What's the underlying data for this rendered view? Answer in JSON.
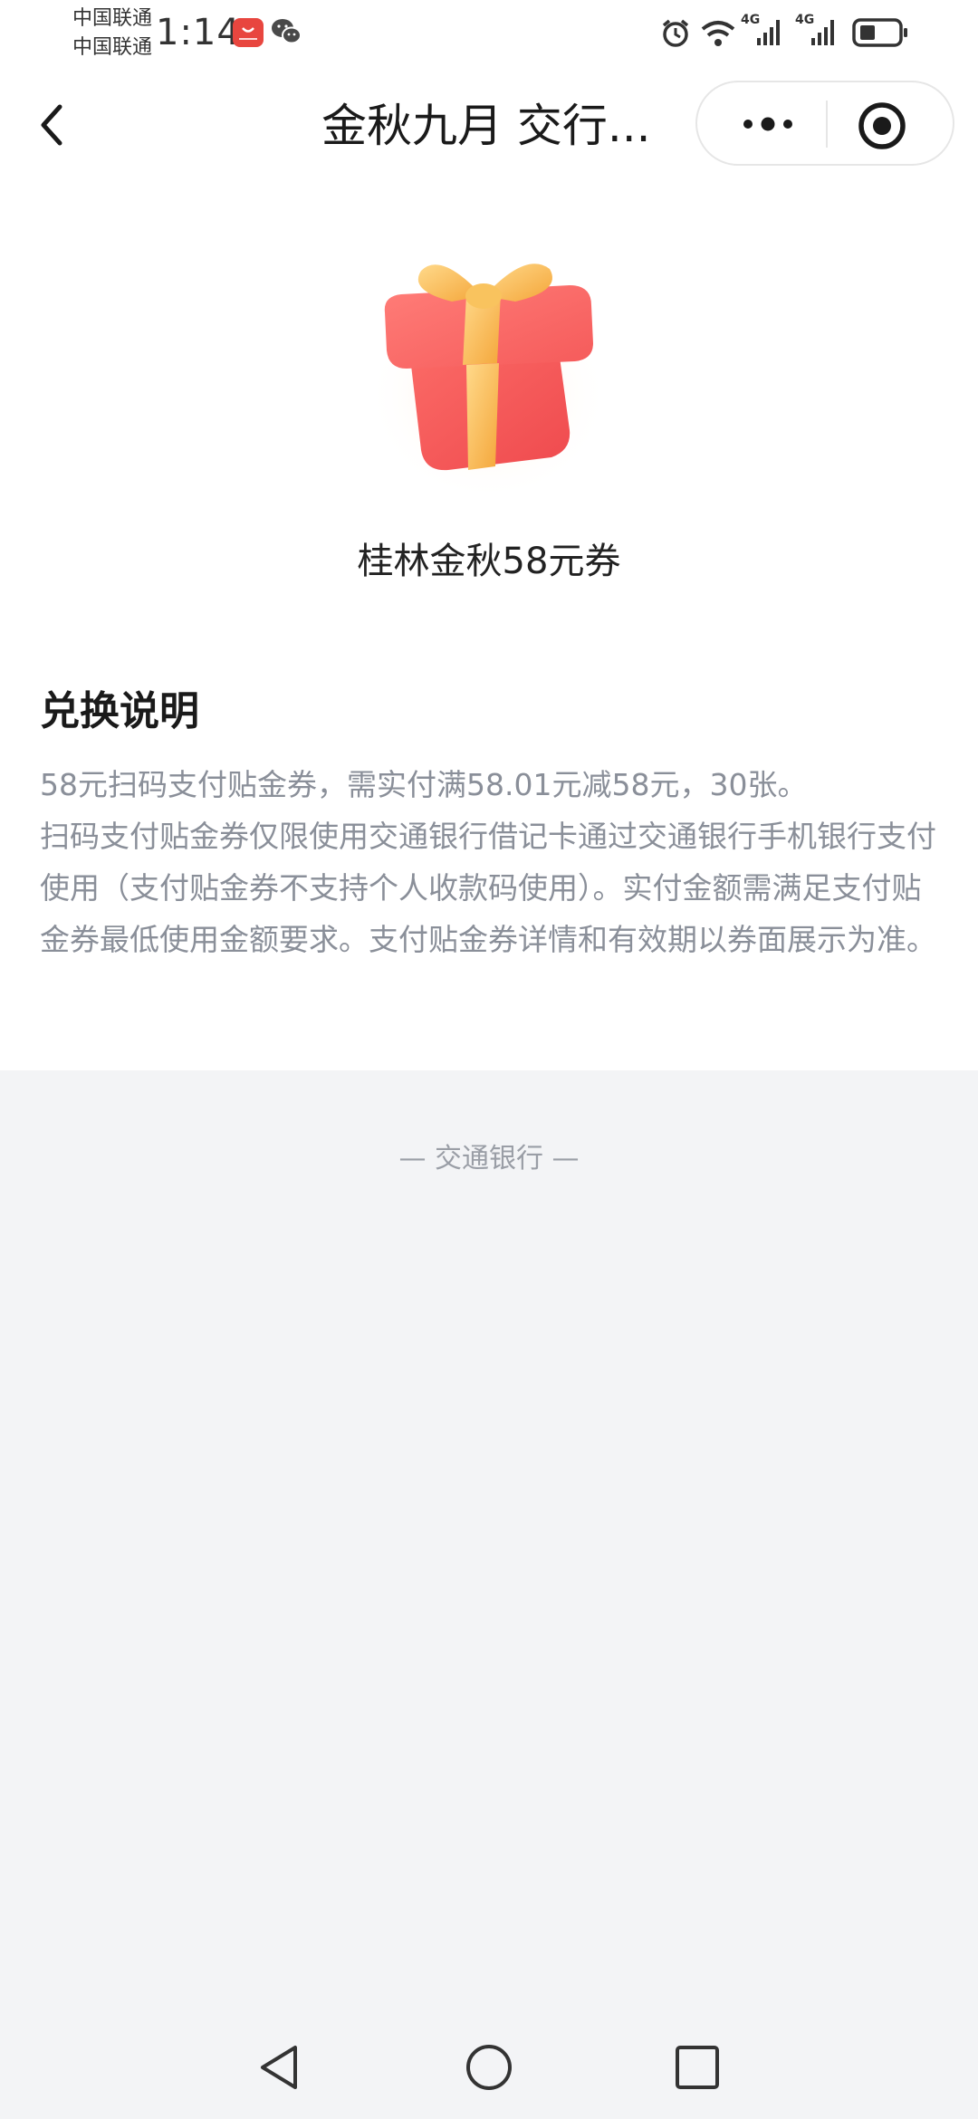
{
  "status_bar": {
    "carrier_1": "中国联通",
    "carrier_2": "中国联通",
    "time": "1:14",
    "network_1": "4G",
    "network_2": "4G",
    "icons": [
      "huawei-appgallery-icon",
      "wechat-icon",
      "alarm-icon",
      "wifi-icon",
      "signal-icon",
      "signal-icon",
      "battery-icon"
    ]
  },
  "nav": {
    "title": "金秋九月 交行...",
    "back_icon": "chevron-left-icon",
    "more_icon": "more-dots-icon",
    "close_icon": "target-close-icon"
  },
  "coupon": {
    "icon": "gift-box-icon",
    "name": "桂林金秋58元券"
  },
  "instructions": {
    "title": "兑换说明",
    "paragraph_1": "58元扫码支付贴金券，需实付满58.01元减58元，30张。",
    "paragraph_2": "扫码支付贴金券仅限使用交通银行借记卡通过交通银行手机银行支付使用（支付贴金券不支持个人收款码使用）。实付金额需满足支付贴金券最低使用金额要求。支付贴金券详情和有效期以券面展示为准。"
  },
  "footer": {
    "bank": "— 交通银行 —"
  },
  "system_nav": {
    "back_icon": "triangle-back-icon",
    "home_icon": "circle-home-icon",
    "recents_icon": "square-recents-icon"
  },
  "colors": {
    "background": "#f3f4f6",
    "card": "#ffffff",
    "secondary_text": "#8a8f99",
    "gift_red": "#f4554f",
    "gift_gold": "#f7b84a"
  }
}
